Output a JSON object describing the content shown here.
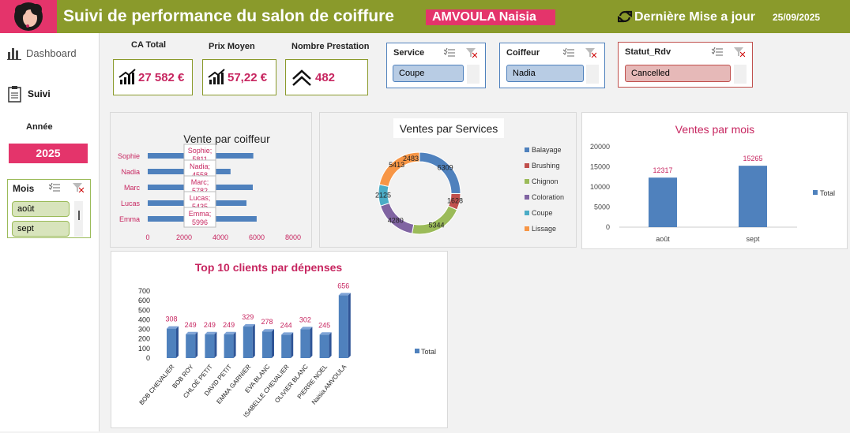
{
  "header": {
    "title": "Suivi de performance du salon de coiffure",
    "name": "AMVOULA Naisia",
    "update_label": "Dernière Mise a jour",
    "update_date": "25/09/2025"
  },
  "sidebar": {
    "dashboard": "Dashboard",
    "suivi": "Suivi",
    "year_label": "Année",
    "year_value": "2025",
    "mois_title": "Mois",
    "mois_items": [
      "août",
      "sept"
    ]
  },
  "kpis": {
    "ca_label": "CA Total",
    "ca_value": "27 582 €",
    "prix_label": "Prix Moyen",
    "prix_value": "57,22 €",
    "nb_label": "Nombre Prestation",
    "nb_value": "482"
  },
  "slicers": {
    "service_title": "Service",
    "service_value": "Coupe",
    "coiffeur_title": "Coiffeur",
    "coiffeur_value": "Nadia",
    "statut_title": "Statut_Rdv",
    "statut_value": "Cancelled"
  },
  "colors": {
    "header_green": "#8a9a2b",
    "accent_pink": "#e4346b",
    "bar_blue": "#4f81bd"
  },
  "chart_data": [
    {
      "type": "bar",
      "orientation": "horizontal",
      "title": "Vente par coiffeur",
      "categories": [
        "Sophie",
        "Nadia",
        "Marc",
        "Lucas",
        "Emma"
      ],
      "values": [
        5811,
        4558,
        5782,
        5435,
        5996
      ],
      "data_labels": [
        "Sophie; 5811",
        "Nadia; 4558",
        "Marc; 5782",
        "Lucas; 5435",
        "Emma; 5996"
      ],
      "xticks": [
        "0",
        "2000",
        "4000",
        "6000",
        "8000"
      ],
      "xlim": [
        0,
        8000
      ]
    },
    {
      "type": "pie",
      "donut": true,
      "title": "Ventes par Services",
      "categories": [
        "Balayage",
        "Brushing",
        "Chignon",
        "Coloration",
        "Coupe",
        "Lissage"
      ],
      "values": [
        6309,
        1628,
        5344,
        4280,
        2125,
        5413
      ],
      "extra_label": "2483",
      "colors": [
        "#4f81bd",
        "#c0504d",
        "#9bbb59",
        "#8064a2",
        "#4bacc6",
        "#f79646"
      ],
      "legend": "right"
    },
    {
      "type": "bar",
      "title": "Ventes par mois",
      "categories": [
        "août",
        "sept"
      ],
      "series": [
        {
          "name": "Total",
          "values": [
            12317,
            15265
          ]
        }
      ],
      "yticks": [
        "0",
        "5000",
        "10000",
        "15000",
        "20000"
      ],
      "ylim": [
        0,
        20000
      ],
      "legend": "right"
    },
    {
      "type": "bar",
      "title": "Top 10 clients par dépenses",
      "categories": [
        "BOB CHEVALIER",
        "BOB ROY",
        "CHLOÉ PETIT",
        "DAVID PETIT",
        "EMMA GARNIER",
        "EVA BLANC",
        "ISABELLE CHEVALIER",
        "OLIVIER BLANC",
        "PIERRE NOEL",
        "Naisia AMVOULA"
      ],
      "series": [
        {
          "name": "Total",
          "values": [
            308,
            249,
            249,
            249,
            329,
            278,
            244,
            302,
            245,
            656
          ]
        }
      ],
      "yticks": [
        "0",
        "100",
        "200",
        "300",
        "400",
        "500",
        "600",
        "700"
      ],
      "ylim": [
        0,
        700
      ],
      "legend": "right"
    }
  ]
}
